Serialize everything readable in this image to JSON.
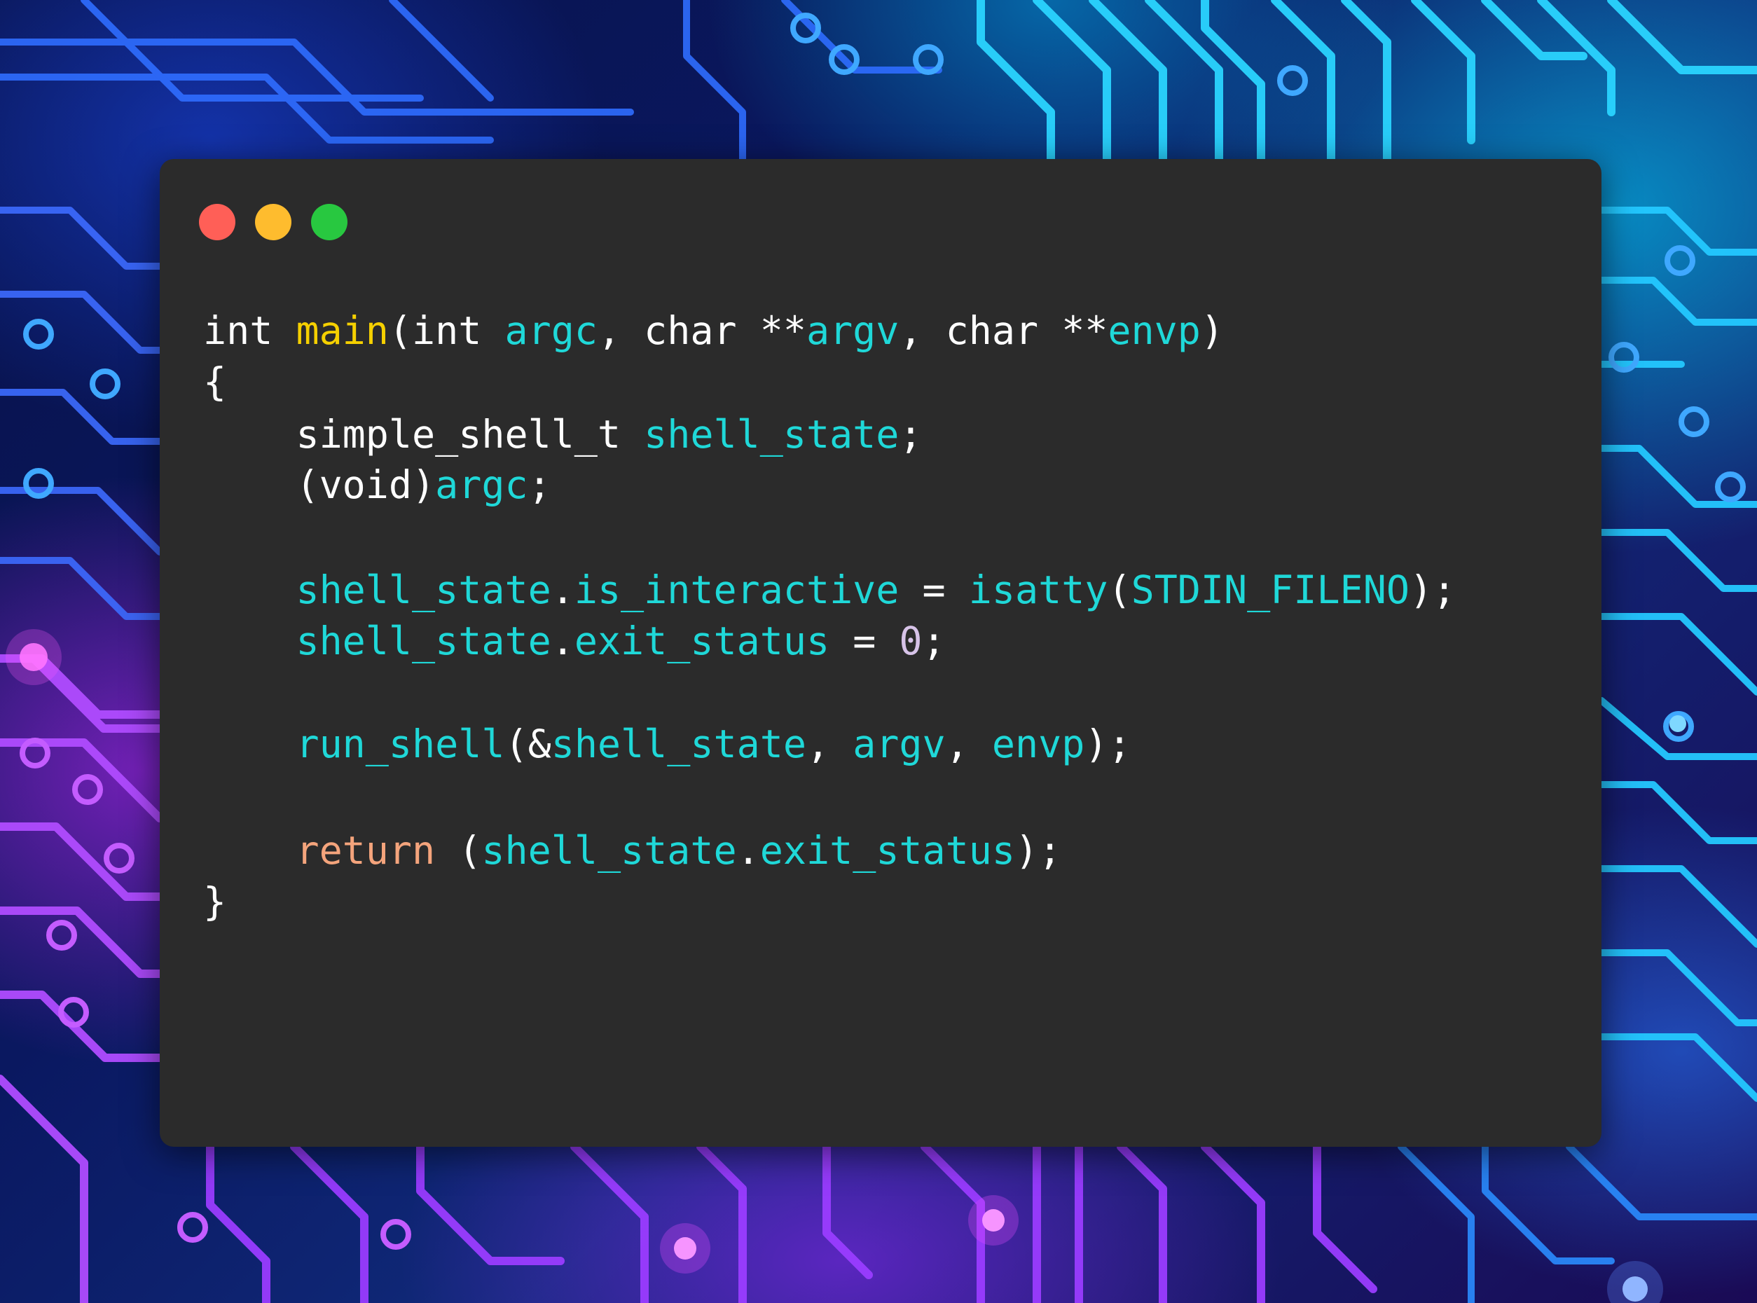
{
  "window": {
    "traffic_lights": {
      "close": "#ff5f57",
      "minimize": "#febc2e",
      "maximize": "#28c840"
    },
    "background": "#2b2b2b"
  },
  "syntax_colors": {
    "plain": "#ffffff",
    "function": "#f5d000",
    "identifier": "#1fd8d8",
    "keyword_return": "#f4a47c",
    "number": "#d7c3e8"
  },
  "code_lines": [
    {
      "tokens": [
        {
          "text": "int ",
          "kind": "plain"
        },
        {
          "text": "main",
          "kind": "function"
        },
        {
          "text": "(int ",
          "kind": "plain"
        },
        {
          "text": "argc",
          "kind": "identifier"
        },
        {
          "text": ", char **",
          "kind": "plain"
        },
        {
          "text": "argv",
          "kind": "identifier"
        },
        {
          "text": ", char **",
          "kind": "plain"
        },
        {
          "text": "envp",
          "kind": "identifier"
        },
        {
          "text": ")",
          "kind": "plain"
        }
      ]
    },
    {
      "tokens": [
        {
          "text": "{",
          "kind": "plain"
        }
      ]
    },
    {
      "tokens": [
        {
          "text": "    simple_shell_t ",
          "kind": "plain"
        },
        {
          "text": "shell_state",
          "kind": "identifier"
        },
        {
          "text": ";",
          "kind": "plain"
        }
      ]
    },
    {
      "tokens": [
        {
          "text": "    (void)",
          "kind": "plain"
        },
        {
          "text": "argc",
          "kind": "identifier"
        },
        {
          "text": ";",
          "kind": "plain"
        }
      ]
    },
    {
      "tokens": [
        {
          "text": "    ",
          "kind": "plain"
        },
        {
          "text": "shell_state",
          "kind": "identifier"
        },
        {
          "text": ".",
          "kind": "plain"
        },
        {
          "text": "is_interactive",
          "kind": "identifier"
        },
        {
          "text": " = ",
          "kind": "plain"
        },
        {
          "text": "isatty",
          "kind": "identifier"
        },
        {
          "text": "(",
          "kind": "plain"
        },
        {
          "text": "STDIN_FILENO",
          "kind": "identifier"
        },
        {
          "text": ");",
          "kind": "plain"
        }
      ]
    },
    {
      "tokens": [
        {
          "text": "    ",
          "kind": "plain"
        },
        {
          "text": "shell_state",
          "kind": "identifier"
        },
        {
          "text": ".",
          "kind": "plain"
        },
        {
          "text": "exit_status",
          "kind": "identifier"
        },
        {
          "text": " = ",
          "kind": "plain"
        },
        {
          "text": "0",
          "kind": "number"
        },
        {
          "text": ";",
          "kind": "plain"
        }
      ]
    },
    {
      "tokens": [
        {
          "text": "    ",
          "kind": "plain"
        },
        {
          "text": "run_shell",
          "kind": "identifier"
        },
        {
          "text": "(&",
          "kind": "plain"
        },
        {
          "text": "shell_state",
          "kind": "identifier"
        },
        {
          "text": ", ",
          "kind": "plain"
        },
        {
          "text": "argv",
          "kind": "identifier"
        },
        {
          "text": ", ",
          "kind": "plain"
        },
        {
          "text": "envp",
          "kind": "identifier"
        },
        {
          "text": ");",
          "kind": "plain"
        }
      ]
    },
    {
      "tokens": [
        {
          "text": "    ",
          "kind": "plain"
        },
        {
          "text": "return",
          "kind": "keyword_return"
        },
        {
          "text": " (",
          "kind": "plain"
        },
        {
          "text": "shell_state",
          "kind": "identifier"
        },
        {
          "text": ".",
          "kind": "plain"
        },
        {
          "text": "exit_status",
          "kind": "identifier"
        },
        {
          "text": ");",
          "kind": "plain"
        }
      ]
    },
    {
      "tokens": [
        {
          "text": "}",
          "kind": "plain"
        }
      ]
    }
  ]
}
